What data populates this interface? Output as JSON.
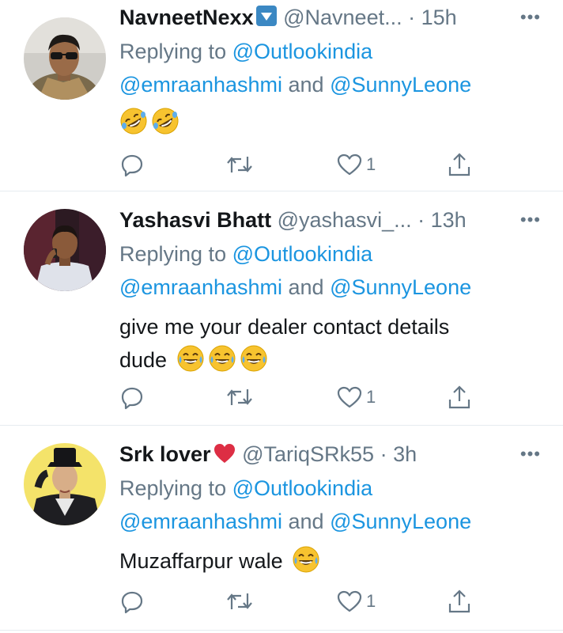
{
  "tweets": [
    {
      "name": "NavneetNexx",
      "handle": "@Navneet...",
      "sep": " · ",
      "time": "15h",
      "more": "•••",
      "replying_prefix": "Replying to ",
      "replying_to_1": "@Outlookindia",
      "replying_to_2": "@emraanhashmi",
      "replying_and": " and ",
      "replying_to_3": "@SunnyLeone",
      "text": "",
      "emojis": [
        "rolling-on-floor-laughing",
        "rolling-on-floor-laughing"
      ],
      "likes": "1"
    },
    {
      "name": "Yashasvi Bhatt",
      "handle": "@yashasvi_...",
      "sep": " · ",
      "time": "13h",
      "more": "•••",
      "replying_prefix": "Replying to ",
      "replying_to_1": "@Outlookindia",
      "replying_to_2": "@emraanhashmi",
      "replying_and": " and ",
      "replying_to_3": "@SunnyLeone",
      "text_line1": "give me your dealer contact details",
      "text_line2": "dude",
      "emojis": [
        "face-with-tears-of-joy",
        "face-with-tears-of-joy",
        "face-with-tears-of-joy"
      ],
      "likes": "1"
    },
    {
      "name": "Srk lover",
      "handle": "@TariqSRk55",
      "sep": " · ",
      "time": "3h",
      "more": "•••",
      "replying_prefix": "Replying to ",
      "replying_to_1": "@Outlookindia",
      "replying_to_2": "@emraanhashmi",
      "replying_and": " and ",
      "replying_to_3": "@SunnyLeone",
      "text": "Muzaffarpur wale",
      "emojis": [
        "face-with-tears-of-joy"
      ],
      "likes": "1"
    }
  ],
  "icons": {
    "reply": "reply-icon",
    "retweet": "retweet-icon",
    "like": "heart-outline-icon",
    "share": "share-icon",
    "verified_badge": "down-arrow-button-emoji",
    "heart_emoji": "red-heart-emoji"
  },
  "colors": {
    "text": "#14171a",
    "secondary": "#657786",
    "link": "#1b95e0",
    "divider": "#e6ecf0",
    "emoji_yellow": "#f7c32f",
    "badge_blue": "#3b88c3",
    "heart_red": "#dd2e44"
  }
}
